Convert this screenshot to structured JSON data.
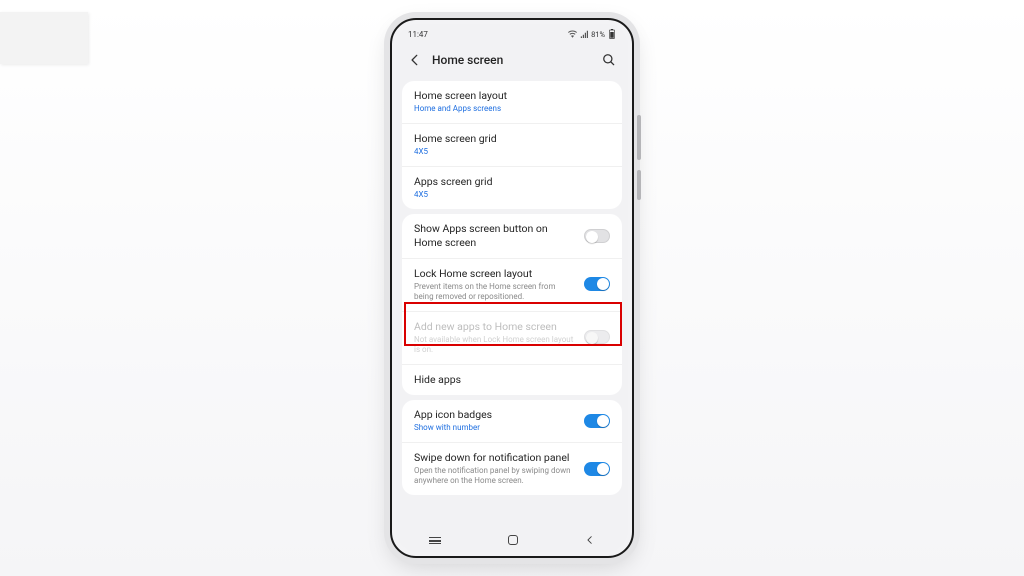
{
  "statusbar": {
    "time": "11:47",
    "battery": "81%"
  },
  "header": {
    "title": "Home screen"
  },
  "groups": [
    {
      "rows": [
        {
          "title": "Home screen layout",
          "subtitle": "Home and Apps screens"
        },
        {
          "title": "Home screen grid",
          "subtitle": "4X5"
        },
        {
          "title": "Apps screen grid",
          "subtitle": "4X5"
        }
      ]
    },
    {
      "rows": [
        {
          "title": "Show Apps screen button on Home screen",
          "toggle": "off"
        },
        {
          "title": "Lock Home screen layout",
          "subtitle": "Prevent items on the Home screen from being removed or repositioned.",
          "toggle": "on",
          "highlighted": true
        },
        {
          "title": "Add new apps to Home screen",
          "subtitle": "Not available when Lock Home screen layout is on.",
          "toggle": "off",
          "disabled": true
        },
        {
          "title": "Hide apps"
        }
      ]
    },
    {
      "rows": [
        {
          "title": "App icon badges",
          "subtitle": "Show with number",
          "toggle": "on"
        },
        {
          "title": "Swipe down for notification panel",
          "subtitle": "Open the notification panel by swiping down anywhere on the Home screen.",
          "toggle": "on"
        }
      ]
    }
  ]
}
